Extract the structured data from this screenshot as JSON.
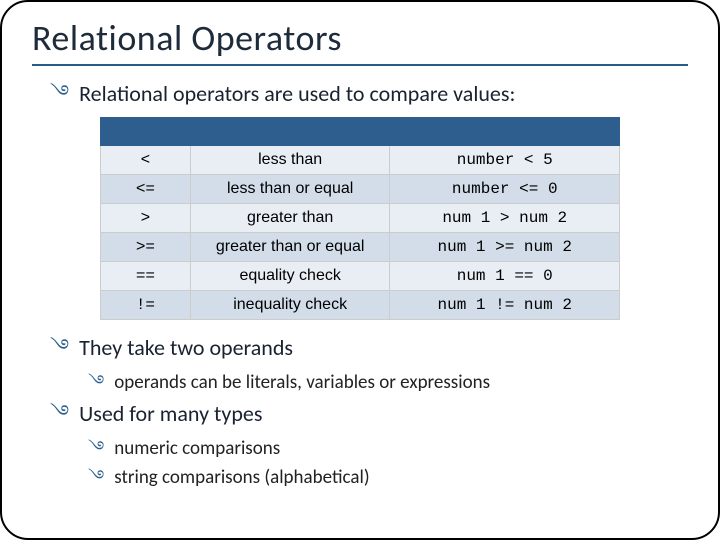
{
  "title": "Relational Operators",
  "intro": "Relational operators are used to compare values:",
  "operators": [
    {
      "sym": "<",
      "desc": "less than",
      "ex": "number < 5"
    },
    {
      "sym": "<=",
      "desc": "less than or equal",
      "ex": "number <= 0"
    },
    {
      "sym": ">",
      "desc": "greater than",
      "ex": "num 1 > num 2"
    },
    {
      "sym": ">=",
      "desc": "greater than or equal",
      "ex": "num 1 >= num 2"
    },
    {
      "sym": "==",
      "desc": "equality check",
      "ex": "num 1 == 0"
    },
    {
      "sym": "!=",
      "desc": "inequality check",
      "ex": "num 1 != num 2"
    }
  ],
  "point_operands": "They take two operands",
  "point_operands_sub": "operands can be literals, variables or expressions",
  "point_types": "Used for many types",
  "point_types_sub1": "numeric comparisons",
  "point_types_sub2": "string comparisons (alphabetical)"
}
